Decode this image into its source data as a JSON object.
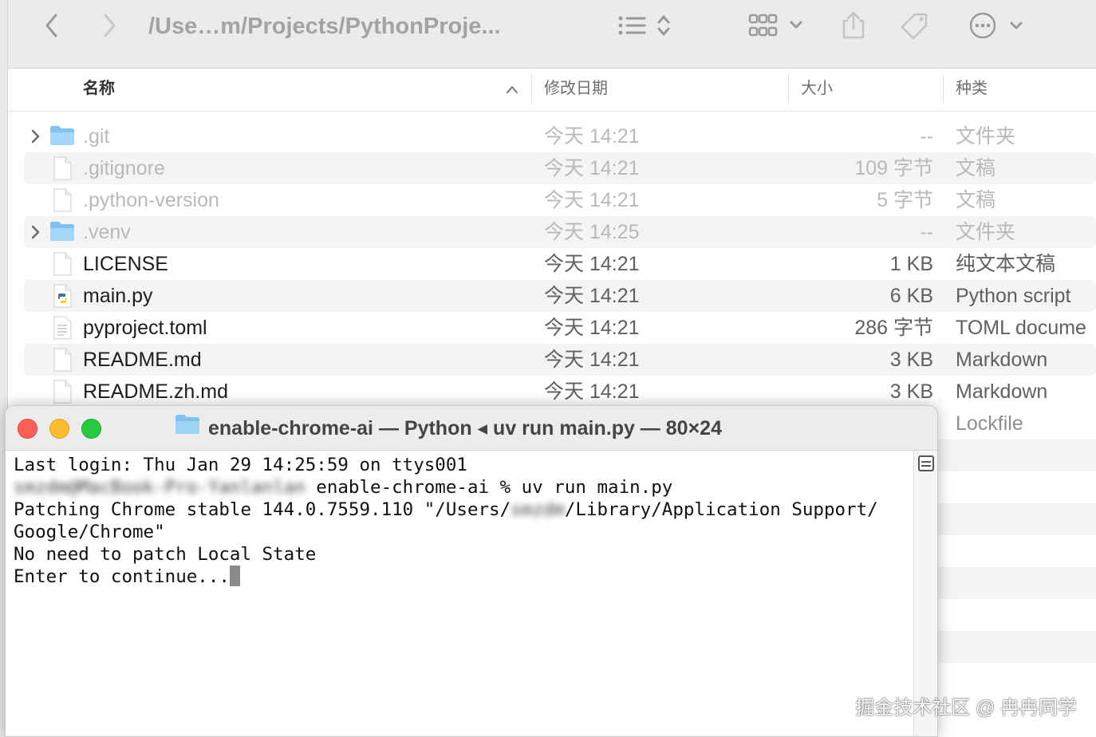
{
  "finder": {
    "path_title": "/Use…m/Projects/PythonProje...",
    "columns": {
      "name": "名称",
      "date": "修改日期",
      "size": "大小",
      "kind": "种类"
    },
    "files": [
      {
        "name": ".git",
        "date": "今天 14:21",
        "size": "--",
        "kind": "文件夹",
        "icon": "folder-icon",
        "expandable": true,
        "dimmed": true
      },
      {
        "name": ".gitignore",
        "date": "今天 14:21",
        "size": "109 字节",
        "kind": "文稿",
        "icon": "document-icon",
        "expandable": false,
        "dimmed": true
      },
      {
        "name": ".python-version",
        "date": "今天 14:21",
        "size": "5 字节",
        "kind": "文稿",
        "icon": "document-icon",
        "expandable": false,
        "dimmed": true
      },
      {
        "name": ".venv",
        "date": "今天 14:25",
        "size": "--",
        "kind": "文件夹",
        "icon": "folder-icon",
        "expandable": true,
        "dimmed": true
      },
      {
        "name": "LICENSE",
        "date": "今天 14:21",
        "size": "1 KB",
        "kind": "纯文本文稿",
        "icon": "document-icon",
        "expandable": false,
        "dimmed": false
      },
      {
        "name": "main.py",
        "date": "今天 14:21",
        "size": "6 KB",
        "kind": "Python script",
        "icon": "python-file-icon",
        "expandable": false,
        "dimmed": false
      },
      {
        "name": "pyproject.toml",
        "date": "今天 14:21",
        "size": "286 字节",
        "kind": "TOML docume",
        "icon": "text-file-icon",
        "expandable": false,
        "dimmed": false
      },
      {
        "name": "README.md",
        "date": "今天 14:21",
        "size": "3 KB",
        "kind": "Markdown",
        "icon": "document-icon",
        "expandable": false,
        "dimmed": false
      },
      {
        "name": "README.zh.md",
        "date": "今天 14:21",
        "size": "3 KB",
        "kind": "Markdown",
        "icon": "document-icon",
        "expandable": false,
        "dimmed": false
      }
    ],
    "partial_row_kind": "Lockfile"
  },
  "terminal": {
    "title": "enable-chrome-ai — Python ◂ uv run main.py — 80×24",
    "lines": {
      "l1": "Last login: Thu Jan 29 14:25:59 on ttys001",
      "l2_blurred": "smzdm@MacBook-Pro-Yanlanlan",
      "l2_rest": " enable-chrome-ai % uv run main.py",
      "l3_a": "Patching Chrome stable 144.0.7559.110 \"/Users/",
      "l3_blurred": "smzdm",
      "l3_b": "/Library/Application Support/",
      "l4": "Google/Chrome\"",
      "l5": "No need to patch Local State",
      "l6": "Enter to continue..."
    }
  },
  "watermark": "掘金技术社区 @ 冉冉同学",
  "colors": {
    "close": "#ff5f57",
    "minimize": "#febc2e",
    "zoom": "#28c840",
    "folder": "#7cc3f0"
  }
}
